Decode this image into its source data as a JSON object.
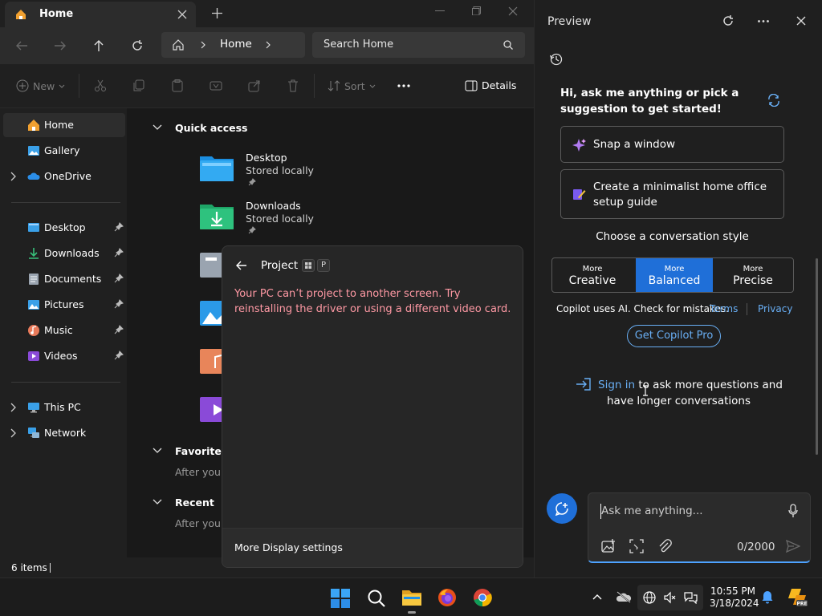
{
  "explorer": {
    "tab_title": "Home",
    "breadcrumb": {
      "home": "Home"
    },
    "search_placeholder": "Search Home",
    "toolbar": {
      "new": "New",
      "sort": "Sort",
      "details": "Details"
    },
    "sidebar": {
      "top": [
        "Home",
        "Gallery",
        "OneDrive"
      ],
      "pinned": [
        "Desktop",
        "Downloads",
        "Documents",
        "Pictures",
        "Music",
        "Videos"
      ],
      "devices": [
        "This PC",
        "Network"
      ]
    },
    "quick_access": {
      "heading": "Quick access",
      "items": [
        {
          "name": "Desktop",
          "sub": "Stored locally"
        },
        {
          "name": "Downloads",
          "sub": "Stored locally"
        }
      ]
    },
    "favorites": {
      "heading": "Favorites",
      "sub": "After you'v"
    },
    "recent": {
      "heading": "Recent",
      "sub": "After you'v"
    },
    "status": "6 items"
  },
  "project": {
    "title": "Project",
    "key": "P",
    "error": "Your PC can’t project to another screen. Try reinstalling the driver or using a different video card.",
    "footer": "More Display settings"
  },
  "copilot": {
    "title": "Preview",
    "greeting": "Hi, ask me anything or pick a suggestion to get started!",
    "suggestions": [
      "Snap a window",
      "Create a minimalist home office setup guide"
    ],
    "style_heading": "Choose a conversation style",
    "styles": [
      {
        "top": "More",
        "label": "Creative"
      },
      {
        "top": "More",
        "label": "Balanced"
      },
      {
        "top": "More",
        "label": "Precise"
      }
    ],
    "disclaimer": "Copilot uses AI. Check for mistakes.",
    "terms": "Terms",
    "privacy": "Privacy",
    "pro_button": "Get Copilot Pro",
    "signin_link": "Sign in",
    "signin_rest1": " to ask more questions and",
    "signin_rest2": "have longer conversations",
    "chat_placeholder": "Ask me anything...",
    "char_count": "0/2000"
  },
  "taskbar": {
    "time": "10:55 PM",
    "date": "3/18/2024"
  },
  "colors": {
    "accent": "#1f6fd8",
    "link": "#69aff5",
    "error": "#ff99a4"
  }
}
